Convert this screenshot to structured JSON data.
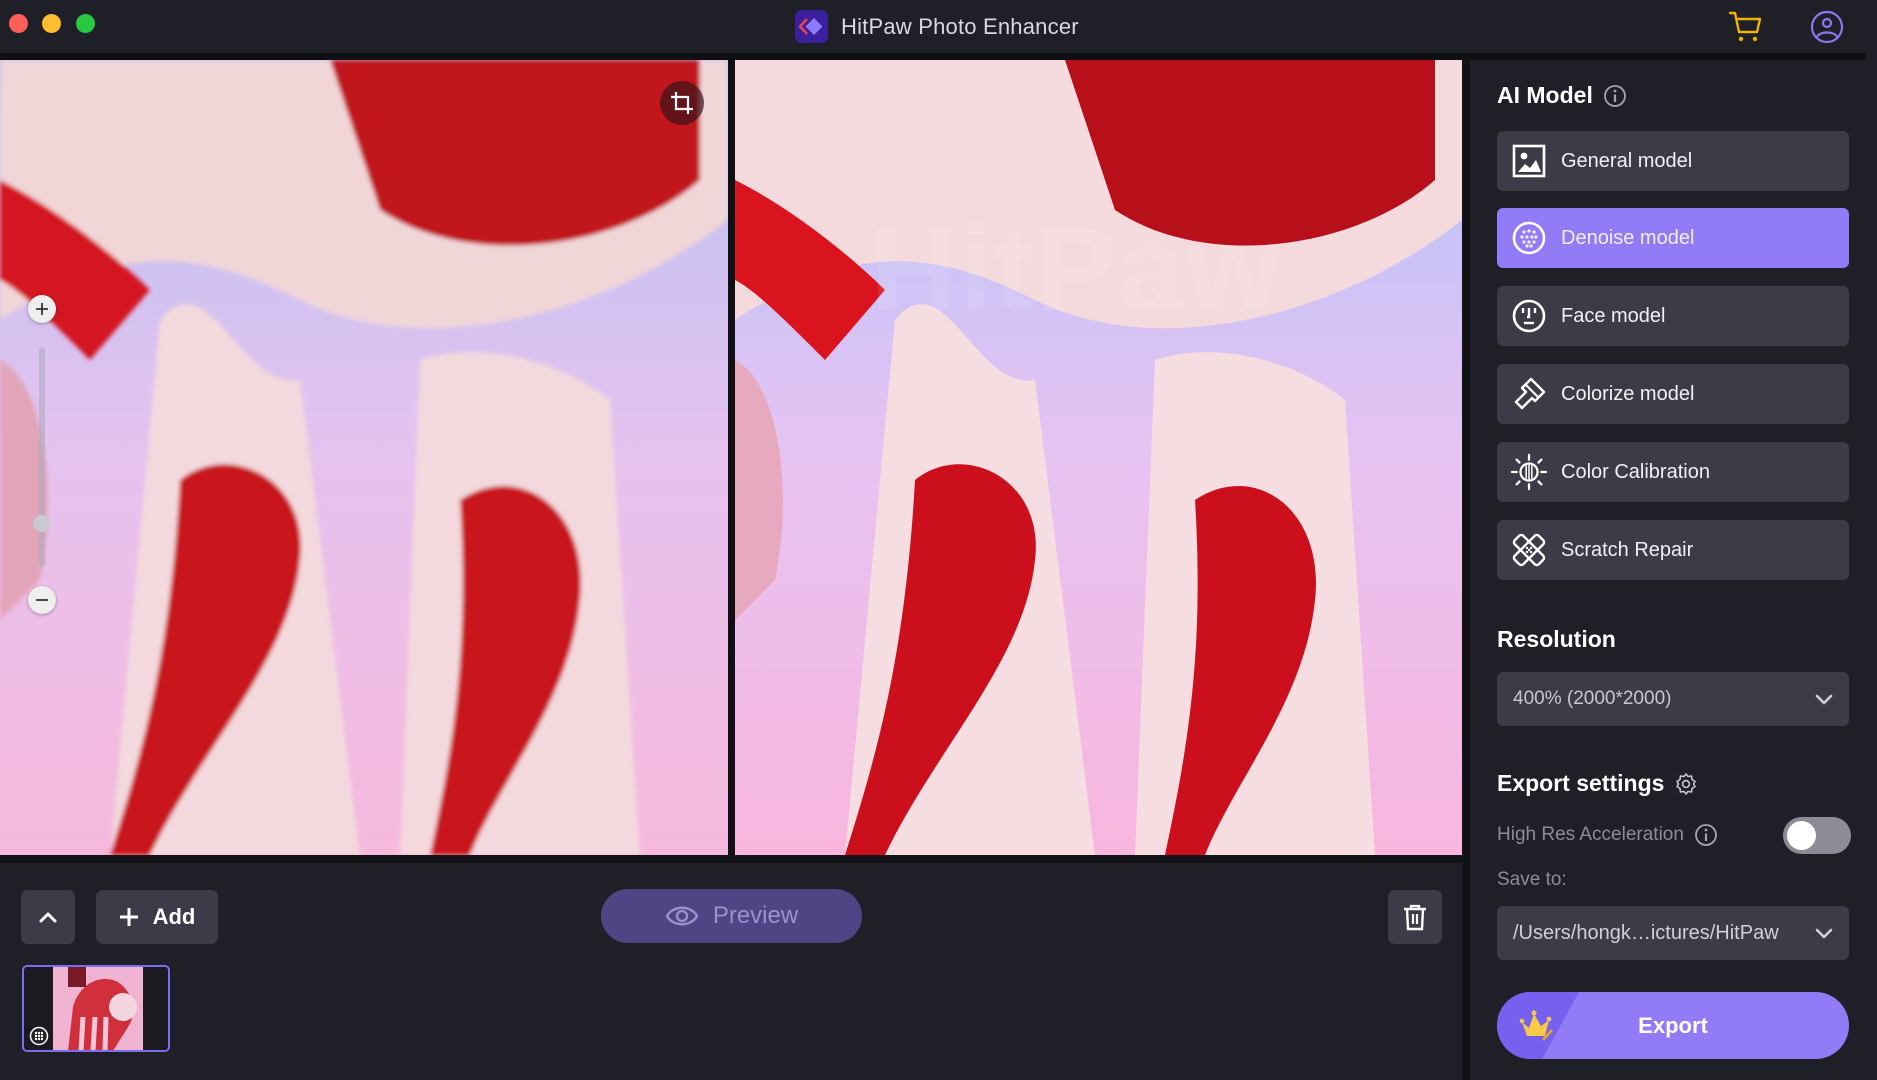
{
  "window": {
    "title": "HitPaw Photo Enhancer",
    "controls": [
      "close",
      "minimize",
      "maximize"
    ],
    "icons": {
      "cart": "cart-icon",
      "account": "user-circle-icon"
    }
  },
  "viewer": {
    "watermark": "HitPaw",
    "zoom_level_fraction": 0.2,
    "icons": {
      "crop": "crop-icon",
      "zoom_in": "plus-icon",
      "zoom_out": "minus-icon"
    }
  },
  "toolbar": {
    "collapse_icon": "chevron-up-icon",
    "add_label": "Add",
    "preview_label": "Preview",
    "delete_icon": "trash-icon"
  },
  "thumbnails": [
    {
      "selected": true,
      "badge_icon": "denoise-icon"
    }
  ],
  "right_panel": {
    "ai_model": {
      "title": "AI Model",
      "models": [
        {
          "label": "General model",
          "icon": "image-icon",
          "active": false
        },
        {
          "label": "Denoise model",
          "icon": "denoise-icon",
          "active": true
        },
        {
          "label": "Face model",
          "icon": "face-icon",
          "active": false
        },
        {
          "label": "Colorize model",
          "icon": "paint-brush-icon",
          "active": false
        },
        {
          "label": "Color Calibration",
          "icon": "brightness-icon",
          "active": false
        },
        {
          "label": "Scratch Repair",
          "icon": "bandage-icon",
          "active": false
        }
      ]
    },
    "resolution": {
      "title": "Resolution",
      "selected": "400% (2000*2000)"
    },
    "export_settings": {
      "title": "Export settings",
      "high_res_label": "High Res Acceleration",
      "high_res_enabled": false,
      "save_to_label": "Save to:",
      "save_path": "/Users/hongk…ictures/HitPaw",
      "export_label": "Export"
    }
  },
  "colors": {
    "accent": "#917bf7",
    "background": "#1f1f27",
    "button": "#3c3b48",
    "preview_button": "#4e4584",
    "cart": "#f0b400",
    "account": "#8a78f0"
  }
}
